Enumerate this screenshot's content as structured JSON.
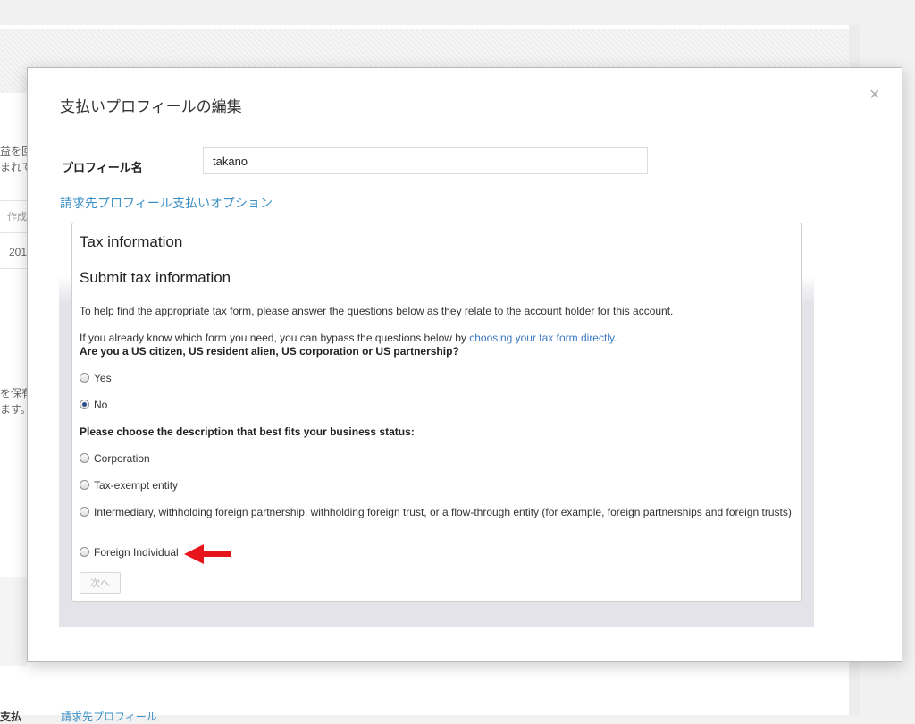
{
  "background": {
    "snippets": [
      {
        "text": "益を回"
      },
      {
        "text": "まれて"
      },
      {
        "text": "作成"
      },
      {
        "text": "201"
      },
      {
        "text": "を保有"
      },
      {
        "text": "ます。"
      },
      {
        "text": "支払"
      },
      {
        "text": "請求先プロフィール"
      }
    ]
  },
  "dialog": {
    "title": "支払いプロフィールの編集",
    "close_glyph": "×",
    "profile_label": "プロフィール名",
    "profile_value": "takano",
    "tabs": [
      "請求先プロフィール",
      "支払いオプション"
    ]
  },
  "tax": {
    "heading": "Tax information",
    "subheading": "Submit tax information",
    "intro": "To help find the appropriate tax form, please answer the questions below as they relate to the account holder for this account.",
    "bypass_prefix": "If you already know which form you need, you can bypass the questions below by ",
    "bypass_link": "choosing your tax form directly",
    "bypass_suffix": ".",
    "q1": "Are you a US citizen, US resident alien, US corporation or US partnership?",
    "q1_options": [
      {
        "label": "Yes",
        "selected": false
      },
      {
        "label": "No",
        "selected": true
      }
    ],
    "q2": "Please choose the description that best fits your business status:",
    "q2_options": [
      {
        "label": "Corporation",
        "selected": false
      },
      {
        "label": "Tax-exempt entity",
        "selected": false
      },
      {
        "label": "Intermediary, withholding foreign partnership, withholding foreign trust, or a flow-through entity (for example, foreign partnerships and foreign trusts)",
        "selected": false
      },
      {
        "label": "Foreign Individual",
        "selected": false
      }
    ],
    "next_label": "次へ"
  },
  "colors": {
    "link": "#3a8fc5",
    "annotation_arrow": "#e8141b"
  },
  "icons": {
    "close": "close-icon",
    "annotation": "red-arrow-icon"
  }
}
